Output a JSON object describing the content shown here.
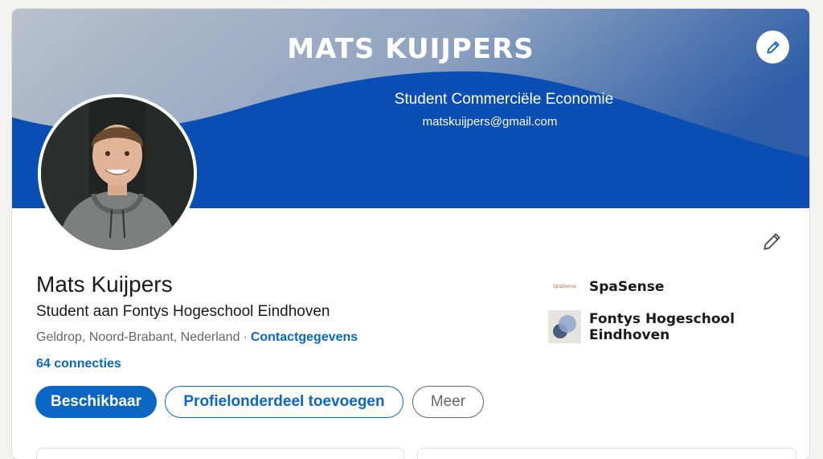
{
  "banner": {
    "title": "MATS KUIJPERS",
    "subtitle": "Student Commerciële Economie",
    "email": "matskuijpers@gmail.com",
    "edit_icon": "pencil-icon",
    "colors": {
      "top": "#7f99bd",
      "wave": "#0a4db3"
    }
  },
  "profile": {
    "name": "Mats Kuijpers",
    "headline": "Student aan Fontys Hogeschool Eindhoven",
    "location": "Geldrop, Noord-Brabant, Nederland",
    "separator": "·",
    "contact_link": "Contactgegevens",
    "connections": "64 connecties",
    "edit_icon": "pencil-icon"
  },
  "actions": {
    "primary": "Beschikbaar",
    "secondary": "Profielonderdeel toevoegen",
    "more": "Meer"
  },
  "organizations": [
    {
      "name": "SpaSense",
      "logo_text": "SpaSense"
    },
    {
      "name": "Fontys Hogeschool Eindhoven",
      "logo_icon": "fontys-logo-icon"
    }
  ],
  "colors": {
    "accent": "#0a66c2",
    "text": "#191919",
    "muted": "#666666"
  }
}
